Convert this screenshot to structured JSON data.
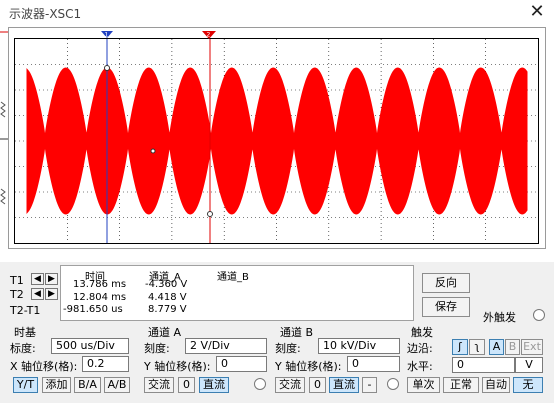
{
  "window": {
    "title": "示波器-XSC1",
    "close_glyph": "✕"
  },
  "cursor_panel": {
    "t1_label": "T1",
    "t2_label": "T2",
    "t2t1_label": "T2-T1",
    "col_time": "时间",
    "col_ch_a": "通道_A",
    "col_ch_b": "通道_B",
    "t1_time": "13.786 ms",
    "t1_a": "-4.360 V",
    "t1_b": "",
    "t2_time": "12.804 ms",
    "t2_a": "4.418 V",
    "t2_b": "",
    "dt_time": "-981.650 us",
    "dt_a": "8.779 V",
    "dt_b": ""
  },
  "buttons": {
    "reverse": "反向",
    "save": "保存",
    "ext_trigger": "外触发"
  },
  "timebase": {
    "title": "时基",
    "scale_label": "标度:",
    "scale_value": "500 us/Div",
    "xpos_label": "X 轴位移(格):",
    "xpos_value": "0.2",
    "yt": "Y/T",
    "add": "添加",
    "ba": "B/A",
    "ab": "A/B"
  },
  "channel_a": {
    "title": "通道 A",
    "scale_label": "刻度:",
    "scale_value": "2  V/Div",
    "ypos_label": "Y 轴位移(格):",
    "ypos_value": "0",
    "ac": "交流",
    "zero": "0",
    "dc": "直流"
  },
  "channel_b": {
    "title": "通道 B",
    "scale_label": "刻度:",
    "scale_value": "10 kV/Div",
    "ypos_label": "Y 轴位移(格):",
    "ypos_value": "0",
    "ac": "交流",
    "zero": "0",
    "dc": "直流",
    "minus": "-"
  },
  "trigger": {
    "title": "触发",
    "edge_label": "边沿:",
    "edge_rise": "ʃ",
    "edge_fall": "ʅ",
    "src_a": "A",
    "src_b": "B",
    "src_ext": "Ext",
    "level_label": "水平:",
    "level_value": "0",
    "level_unit": "V",
    "single": "单次",
    "normal": "正常",
    "auto": "自动",
    "none": "无"
  },
  "colors": {
    "trace_a": "#ff0000",
    "cursor_t1": "#2040c0",
    "cursor_t2": "#e00000",
    "grid": "#000000"
  },
  "chart_data": {
    "type": "line",
    "signal": "amplitude-modulated sine (beats)",
    "time_div": "500 us/Div",
    "volts_div": "2 V/Div",
    "cursors": {
      "t1": "13.786 ms",
      "t2": "12.804 ms"
    }
  }
}
